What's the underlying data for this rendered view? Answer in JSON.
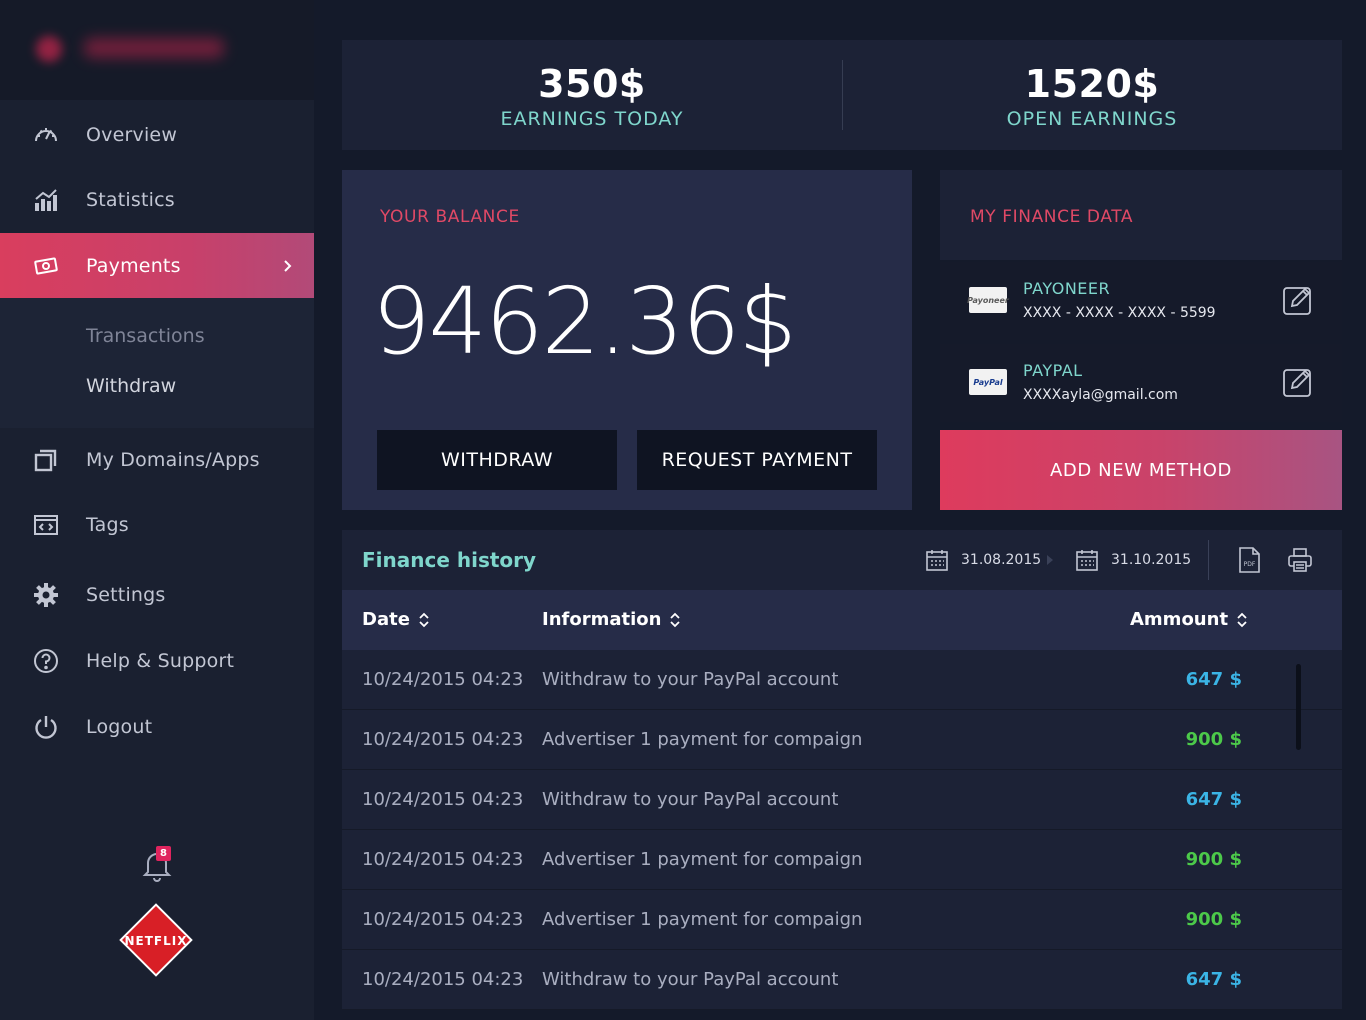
{
  "sidebar": {
    "nav": [
      {
        "label": "Overview",
        "icon": "speedometer-icon"
      },
      {
        "label": "Statistics",
        "icon": "bar-chart-icon"
      },
      {
        "label": "Payments",
        "icon": "money-icon"
      },
      {
        "label": "My Domains/Apps",
        "icon": "windows-icon"
      },
      {
        "label": "Tags",
        "icon": "code-tag-icon"
      },
      {
        "label": "Settings",
        "icon": "gear-icon"
      },
      {
        "label": "Help & Support",
        "icon": "help-icon"
      },
      {
        "label": "Logout",
        "icon": "power-icon"
      }
    ],
    "subnav": [
      {
        "label": "Transactions"
      },
      {
        "label": "Withdraw"
      }
    ],
    "notifications_count": "8",
    "logo_text": "NETFLIX"
  },
  "stats": {
    "earnings_today_value": "350$",
    "earnings_today_label": "EARNINGS TODAY",
    "open_earnings_value": "1520$",
    "open_earnings_label": "OPEN EARNINGS"
  },
  "balance": {
    "title": "YOUR BALANCE",
    "amount": "9462.36$",
    "withdraw_label": "WITHDRAW",
    "request_label": "REQUEST PAYMENT"
  },
  "finance": {
    "title": "MY FINANCE DATA",
    "methods": [
      {
        "name": "PAYONEER",
        "detail": "XXXX - XXXX - XXXX - 5599",
        "logo": "Payoneer"
      },
      {
        "name": "PAYPAL",
        "detail": "XXXXayla@gmail.com",
        "logo": "PayPal"
      }
    ],
    "add_label": "ADD NEW METHOD"
  },
  "history": {
    "title": "Finance history",
    "date_from": "31.08.2015",
    "date_to": "31.10.2015",
    "pdf_label": "PDF",
    "columns": [
      "Date",
      "Information",
      "Ammount"
    ],
    "rows": [
      {
        "date": "10/24/2015 04:23",
        "info": "Withdraw to your PayPal account",
        "amount": "647 $",
        "kind": "withdraw"
      },
      {
        "date": "10/24/2015 04:23",
        "info": "Advertiser 1 payment for compaign",
        "amount": "900 $",
        "kind": "payment"
      },
      {
        "date": "10/24/2015 04:23",
        "info": "Withdraw to your PayPal account",
        "amount": "647 $",
        "kind": "withdraw"
      },
      {
        "date": "10/24/2015 04:23",
        "info": "Advertiser 1 payment for compaign",
        "amount": "900 $",
        "kind": "payment"
      },
      {
        "date": "10/24/2015 04:23",
        "info": "Advertiser 1 payment for compaign",
        "amount": "900 $",
        "kind": "payment"
      },
      {
        "date": "10/24/2015 04:23",
        "info": "Withdraw to your PayPal account",
        "amount": "647 $",
        "kind": "withdraw"
      }
    ]
  },
  "colors": {
    "accent": "#e04966",
    "teal": "#7fd6cc",
    "withdraw_amount": "#3bb4e5",
    "payment_amount": "#4cc94a"
  }
}
